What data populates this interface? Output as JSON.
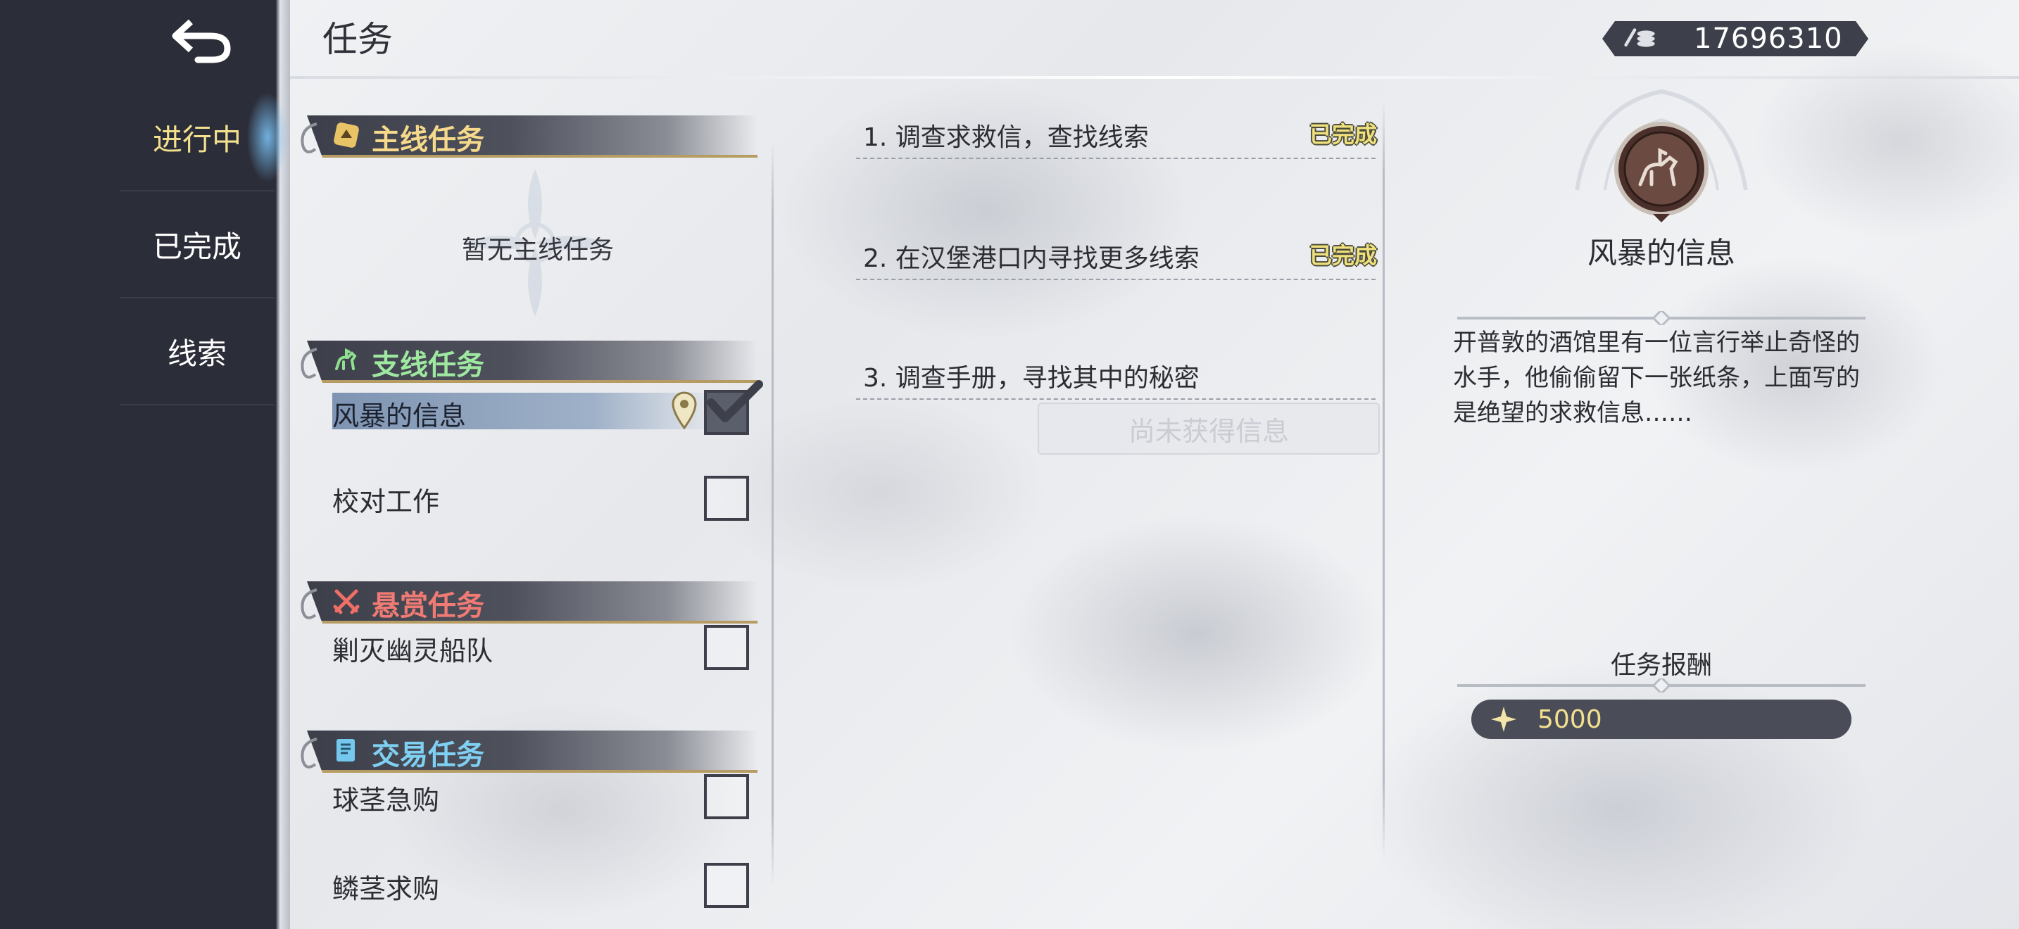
{
  "header": {
    "title": "任务",
    "currency_value": "17696310",
    "currency_icon": "coins-icon"
  },
  "sidebar": {
    "back_icon": "back-arrow-icon",
    "tabs": [
      {
        "label": "进行中",
        "active": true
      },
      {
        "label": "已完成",
        "active": false
      },
      {
        "label": "线索",
        "active": false
      }
    ]
  },
  "quest_list": {
    "categories": [
      {
        "label": "主线任务",
        "icon": "scroll-emblem-icon",
        "empty_text": "暂无主线任务",
        "quests": []
      },
      {
        "label": "支线任务",
        "icon": "horse-rider-icon",
        "quests": [
          {
            "label": "风暴的信息",
            "selected": true,
            "tracked": true
          },
          {
            "label": "校对工作",
            "selected": false,
            "tracked": false
          }
        ]
      },
      {
        "label": "悬赏任务",
        "icon": "crossed-swords-icon",
        "quests": [
          {
            "label": "剿灭幽灵船队",
            "selected": false,
            "tracked": false
          }
        ]
      },
      {
        "label": "交易任务",
        "icon": "contract-scroll-icon",
        "quests": [
          {
            "label": "球茎急购",
            "selected": false,
            "tracked": false
          },
          {
            "label": "鳞茎求购",
            "selected": false,
            "tracked": false
          }
        ]
      }
    ]
  },
  "objectives": {
    "items": [
      {
        "text": "1.  调查求救信，查找线索",
        "status": "已完成"
      },
      {
        "text": "2.  在汉堡港口内寻找更多线索",
        "status": "已完成"
      },
      {
        "text": "3.  调查手册，寻找其中的秘密",
        "status": ""
      }
    ],
    "locked_button": "尚未获得信息"
  },
  "detail": {
    "emblem_icon": "knight-emblem-icon",
    "title": "风暴的信息",
    "description": "开普敦的酒馆里有一位言行举止奇怪的水手，他偷偷留下一张纸条，上面写的是绝望的求救信息……",
    "reward_title": "任务报酬",
    "reward_icon": "star-sparkle-icon",
    "reward_value": "5000"
  },
  "colors": {
    "sidebar": "#2b2d38",
    "active_tab": "#f2e08e",
    "completed_status": "#efe07d",
    "main_quest": "#f6d98a",
    "side_quest": "#9fe8a0",
    "bounty_quest": "#f07b74",
    "trade_quest": "#7fd0f2"
  }
}
